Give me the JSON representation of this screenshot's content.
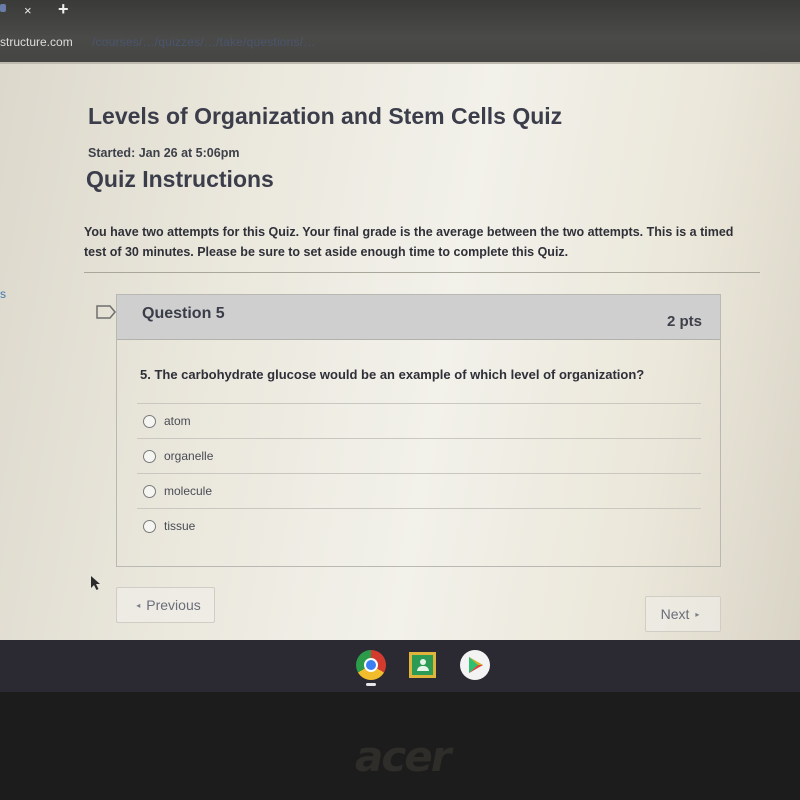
{
  "browser": {
    "tab_close_icon": "×",
    "new_tab_icon": "+",
    "url_host": "structure.com",
    "url_path": "/courses/…/quizzes/…/take/questions/…"
  },
  "sidebar": {
    "link_fragment": "s"
  },
  "quiz": {
    "title": "Levels of Organization and Stem Cells Quiz",
    "started": "Started: Jan 26 at 5:06pm",
    "instructions_heading": "Quiz Instructions",
    "instructions_text": "You have two attempts for this Quiz.  Your final grade is the average between the two attempts.  This is a timed test of 30 minutes.  Please be sure to set aside enough time to complete this Quiz."
  },
  "question": {
    "number_label": "Question 5",
    "points": "2 pts",
    "text": "5. The carbohydrate glucose would be an example of which level of organization?",
    "answers": [
      {
        "label": "atom",
        "selected": false
      },
      {
        "label": "organelle",
        "selected": false
      },
      {
        "label": "molecule",
        "selected": false
      },
      {
        "label": "tissue",
        "selected": false
      }
    ]
  },
  "navigation": {
    "previous_label": "Previous",
    "next_label": "Next",
    "previous_icon": "◂",
    "next_icon": "▸"
  },
  "shelf": {
    "apps": [
      "chrome-icon",
      "google-classroom-icon",
      "play-store-icon"
    ]
  },
  "device": {
    "brand": "acer"
  }
}
